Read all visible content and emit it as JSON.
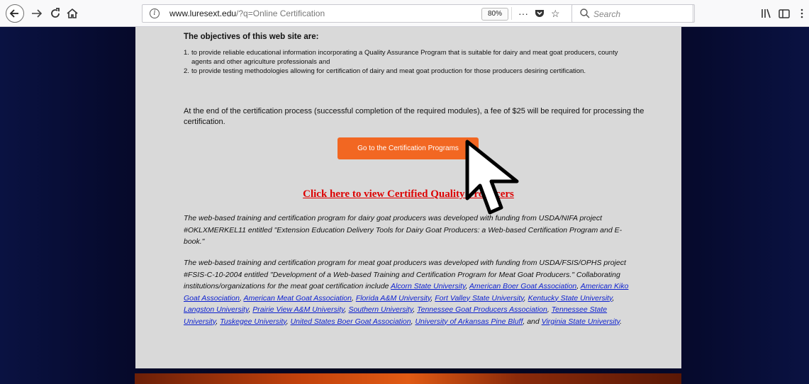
{
  "browser": {
    "url_host": "www.luresext.edu",
    "url_path": "/?q=Online Certification",
    "zoom": "80%",
    "search_placeholder": "Search",
    "icons": [
      "back-icon",
      "forward-icon",
      "reload-icon",
      "home-icon",
      "info-icon",
      "page-actions-icon",
      "pocket-icon",
      "bookmark-star-icon",
      "search-icon",
      "library-icon",
      "sidebar-icon",
      "overflow-menu-icon"
    ]
  },
  "page": {
    "objectives_heading": "The objectives of this web site are:",
    "objectives": [
      {
        "num": "1.",
        "text": "to provide reliable educational information incorporating a Quality Assurance Program that is suitable for dairy and meat goat producers, county agents and other agriculture professionals and"
      },
      {
        "num": "2.",
        "text": "to provide testing methodologies allowing for certification of dairy and meat goat production for those producers desiring certification."
      }
    ],
    "fee_text": "At the end of the certification process (successful completion of the required modules), a fee of $25 will be required for processing the certification.",
    "cta_label": "Go to the Certification Programs",
    "certified_link": "Click here to view Certified Quality Producers",
    "dairy_funding": "The web-based training and certification program for dairy goat producers was developed with funding from USDA/NIFA project #OKLXMERKEL11 entitled \"Extension Education Delivery Tools for Dairy Goat Producers: a Web-based Certification Program and E-book.\"",
    "meat_funding_intro": "The web-based training and certification program for meat goat producers was developed with funding from USDA/FSIS/OPHS project #FSIS-C-10-2004 entitled \"Development of a Web-based Training and Certification Program for Meat Goat Producers.\" Collaborating institutions/organizations for the meat goat certification include",
    "institutions": [
      "Alcorn State University",
      "American Boer Goat Association",
      "American Kiko Goat Association",
      "American Meat Goat Association",
      "Florida A&M University",
      "Fort Valley State University",
      "Kentucky State University",
      "Langston University",
      "Prairie View A&M University",
      "Southern University",
      "Tennessee Goat Producers Association",
      "Tennessee State University",
      "Tuskegee University",
      "United States Boer Goat Association",
      "University of Arkansas Pine Bluff",
      "Virginia State University"
    ],
    "separator": ",",
    "last_join": ", and",
    "end_punct": "."
  }
}
